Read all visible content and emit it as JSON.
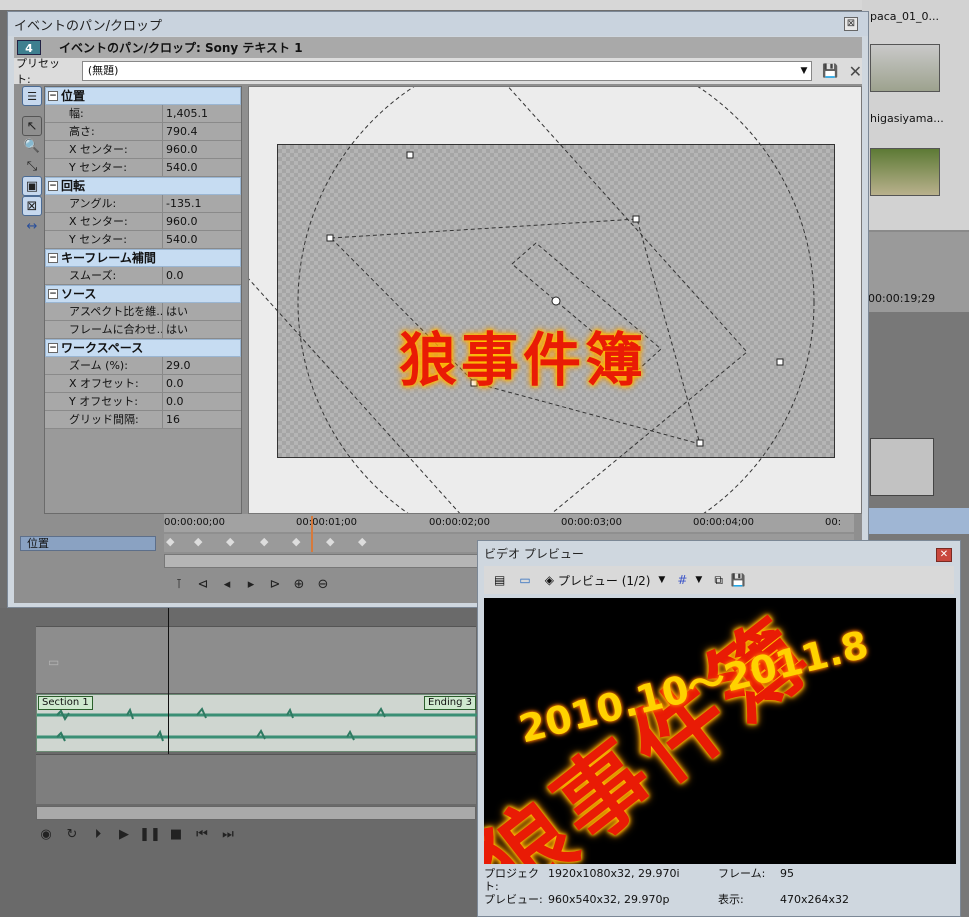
{
  "background": {
    "media_labels": [
      "paca_01_0...",
      "higasiyama..."
    ],
    "timecode_right": "00:00:19;29",
    "markers": [
      "Section 1",
      "Ending 3"
    ]
  },
  "pancrop": {
    "title": "イベントのパン/クロップ",
    "badge": "4",
    "header": "イベントのパン/クロップ: Sony テキスト 1",
    "preset_label": "プリセット:",
    "preset_value": "(無題)",
    "sections": [
      {
        "name": "位置",
        "rows": [
          {
            "k": "幅:",
            "v": "1,405.1"
          },
          {
            "k": "高さ:",
            "v": "790.4"
          },
          {
            "k": "X センター:",
            "v": "960.0"
          },
          {
            "k": "Y センター:",
            "v": "540.0"
          }
        ]
      },
      {
        "name": "回転",
        "rows": [
          {
            "k": "アングル:",
            "v": "-135.1"
          },
          {
            "k": "X センター:",
            "v": "960.0"
          },
          {
            "k": "Y センター:",
            "v": "540.0"
          }
        ]
      },
      {
        "name": "キーフレーム補間",
        "rows": [
          {
            "k": "スムーズ:",
            "v": "0.0"
          }
        ]
      },
      {
        "name": "ソース",
        "rows": [
          {
            "k": "アスペクト比を維...",
            "v": "はい"
          },
          {
            "k": "フレームに合わせ...",
            "v": "はい"
          }
        ]
      },
      {
        "name": "ワークスペース",
        "rows": [
          {
            "k": "ズーム (%):",
            "v": "29.0"
          },
          {
            "k": "X オフセット:",
            "v": "0.0"
          },
          {
            "k": "Y オフセット:",
            "v": "0.0"
          },
          {
            "k": "グリッド間隔:",
            "v": "16"
          }
        ]
      }
    ],
    "canvas_text": "狼事件簿",
    "timeline_track_label": "位置",
    "timecodes": [
      "00:00:00;00",
      "00:00:01;00",
      "00:00:02;00",
      "00:00:03;00",
      "00:00:04;00",
      "00:"
    ]
  },
  "preview": {
    "title": "ビデオ プレビュー",
    "mode": "プレビュー (1/2)",
    "overlay_text": "2010.10〜2011.8",
    "big_text": "狼事件簿",
    "info": {
      "project_label": "プロジェクト:",
      "project_value": "1920x1080x32, 29.970i",
      "frame_label": "フレーム:",
      "frame_value": "95",
      "preview_label": "プレビュー:",
      "preview_value": "960x540x32, 29.970p",
      "display_label": "表示:",
      "display_value": "470x264x32"
    }
  }
}
